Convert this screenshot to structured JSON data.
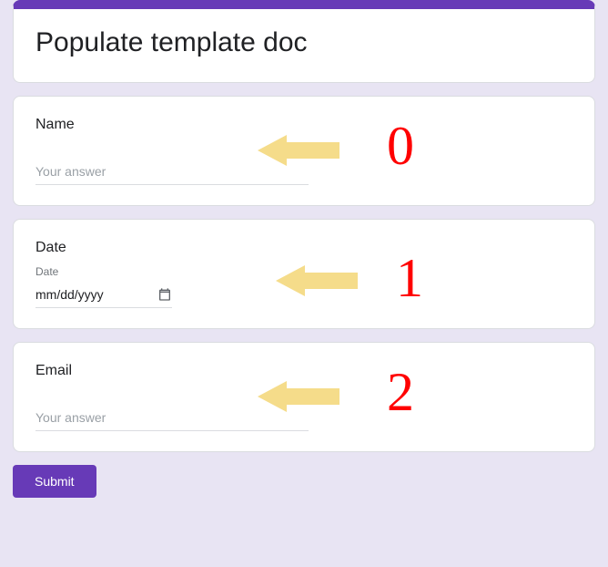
{
  "form": {
    "title": "Populate template doc"
  },
  "questions": {
    "name": {
      "label": "Name",
      "placeholder": "Your answer"
    },
    "date": {
      "label": "Date",
      "sublabel": "Date",
      "placeholder": "mm/dd/yyyy"
    },
    "email": {
      "label": "Email",
      "placeholder": "Your answer"
    }
  },
  "buttons": {
    "submit": "Submit"
  },
  "annotations": {
    "a0": "0",
    "a1": "1",
    "a2": "2"
  }
}
